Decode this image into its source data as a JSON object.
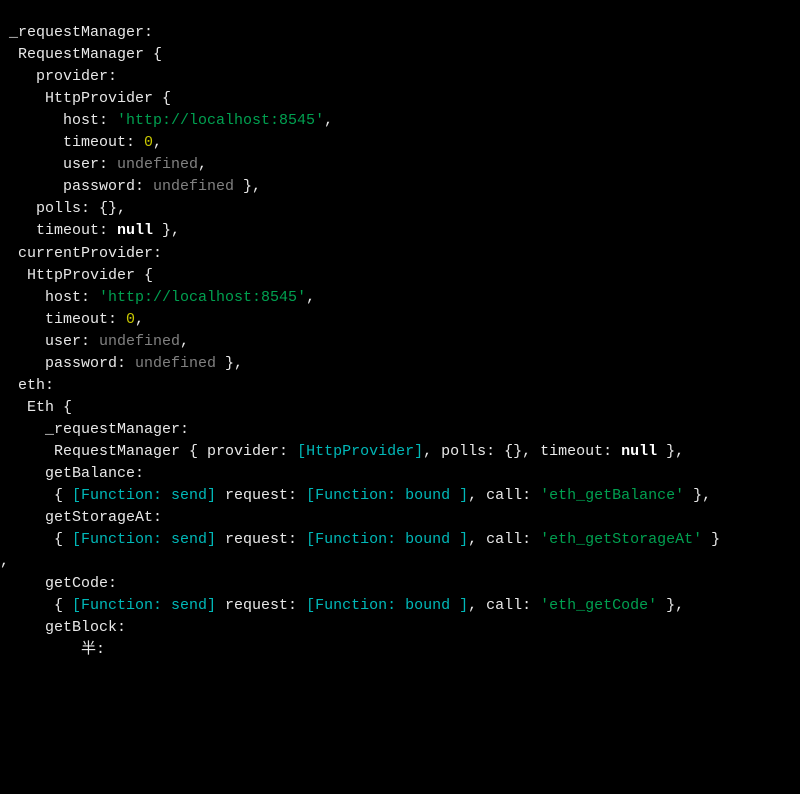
{
  "lines": [
    [
      {
        "t": " _requestManager:",
        "c": "w"
      }
    ],
    [
      {
        "t": "  RequestManager {",
        "c": "w"
      }
    ],
    [
      {
        "t": "    provider:",
        "c": "w"
      }
    ],
    [
      {
        "t": "     HttpProvider {",
        "c": "w"
      }
    ],
    [
      {
        "t": "       host: ",
        "c": "w"
      },
      {
        "t": "'http://localhost:8545'",
        "c": "g"
      },
      {
        "t": ",",
        "c": "w"
      }
    ],
    [
      {
        "t": "       timeout: ",
        "c": "w"
      },
      {
        "t": "0",
        "c": "y"
      },
      {
        "t": ",",
        "c": "w"
      }
    ],
    [
      {
        "t": "       user: ",
        "c": "w"
      },
      {
        "t": "undefined",
        "c": "d"
      },
      {
        "t": ",",
        "c": "w"
      }
    ],
    [
      {
        "t": "       password: ",
        "c": "w"
      },
      {
        "t": "undefined",
        "c": "d"
      },
      {
        "t": " },",
        "c": "w"
      }
    ],
    [
      {
        "t": "    polls: {},",
        "c": "w"
      }
    ],
    [
      {
        "t": "    timeout: ",
        "c": "w"
      },
      {
        "t": "null",
        "c": "k"
      },
      {
        "t": " },",
        "c": "w"
      }
    ],
    [
      {
        "t": "  currentProvider:",
        "c": "w"
      }
    ],
    [
      {
        "t": "   HttpProvider {",
        "c": "w"
      }
    ],
    [
      {
        "t": "     host: ",
        "c": "w"
      },
      {
        "t": "'http://localhost:8545'",
        "c": "g"
      },
      {
        "t": ",",
        "c": "w"
      }
    ],
    [
      {
        "t": "     timeout: ",
        "c": "w"
      },
      {
        "t": "0",
        "c": "y"
      },
      {
        "t": ",",
        "c": "w"
      }
    ],
    [
      {
        "t": "     user: ",
        "c": "w"
      },
      {
        "t": "undefined",
        "c": "d"
      },
      {
        "t": ",",
        "c": "w"
      }
    ],
    [
      {
        "t": "     password: ",
        "c": "w"
      },
      {
        "t": "undefined",
        "c": "d"
      },
      {
        "t": " },",
        "c": "w"
      }
    ],
    [
      {
        "t": "  eth:",
        "c": "w"
      }
    ],
    [
      {
        "t": "   Eth {",
        "c": "w"
      }
    ],
    [
      {
        "t": "     _requestManager:",
        "c": "w"
      }
    ],
    [
      {
        "t": "      RequestManager { provider: ",
        "c": "w"
      },
      {
        "t": "[HttpProvider]",
        "c": "c"
      },
      {
        "t": ", polls: {}, timeout: ",
        "c": "w"
      },
      {
        "t": "null",
        "c": "k"
      },
      {
        "t": " },",
        "c": "w"
      }
    ],
    [
      {
        "t": "     getBalance:",
        "c": "w"
      }
    ],
    [
      {
        "t": "      { ",
        "c": "w"
      },
      {
        "t": "[Function: send]",
        "c": "c"
      },
      {
        "t": " request: ",
        "c": "w"
      },
      {
        "t": "[Function: bound ]",
        "c": "c"
      },
      {
        "t": ", call: ",
        "c": "w"
      },
      {
        "t": "'eth_getBalance'",
        "c": "g"
      },
      {
        "t": " },",
        "c": "w"
      }
    ],
    [
      {
        "t": "     getStorageAt:",
        "c": "w"
      }
    ],
    [
      {
        "t": "      { ",
        "c": "w"
      },
      {
        "t": "[Function: send]",
        "c": "c"
      },
      {
        "t": " request: ",
        "c": "w"
      },
      {
        "t": "[Function: bound ]",
        "c": "c"
      },
      {
        "t": ", call: ",
        "c": "w"
      },
      {
        "t": "'eth_getStorageAt'",
        "c": "g"
      },
      {
        "t": " }",
        "c": "w"
      }
    ],
    [
      {
        "t": ",",
        "c": "w"
      }
    ],
    [
      {
        "t": "     getCode:",
        "c": "w"
      }
    ],
    [
      {
        "t": "      { ",
        "c": "w"
      },
      {
        "t": "[Function: send]",
        "c": "c"
      },
      {
        "t": " request: ",
        "c": "w"
      },
      {
        "t": "[Function: bound ]",
        "c": "c"
      },
      {
        "t": ", call: ",
        "c": "w"
      },
      {
        "t": "'eth_getCode'",
        "c": "g"
      },
      {
        "t": " },",
        "c": "w"
      }
    ],
    [
      {
        "t": "     getBlock:",
        "c": "w"
      }
    ],
    [
      {
        "t": "         半:",
        "c": "w"
      }
    ]
  ]
}
